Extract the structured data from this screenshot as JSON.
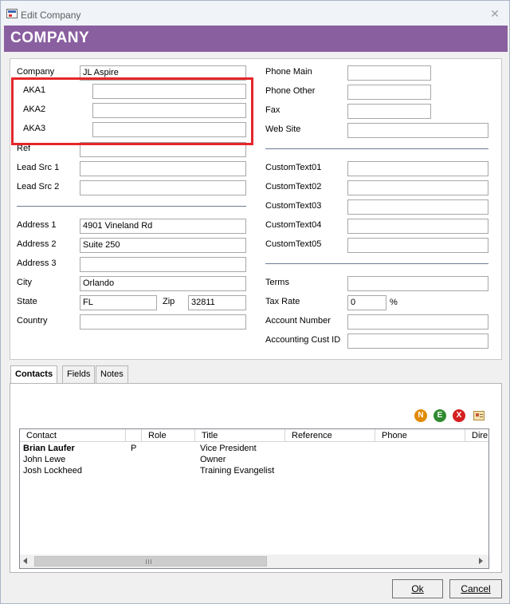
{
  "window": {
    "title": "Edit Company",
    "close_glyph": "✕"
  },
  "header": {
    "title": "COMPANY",
    "accent_color": "#8a5fa0"
  },
  "left": {
    "company": {
      "label": "Company",
      "value": "JL Aspire"
    },
    "aka1": {
      "label": "AKA1",
      "value": ""
    },
    "aka2": {
      "label": "AKA2",
      "value": ""
    },
    "aka3": {
      "label": "AKA3",
      "value": ""
    },
    "ref": {
      "label": "Ref",
      "value": ""
    },
    "lead_src_1": {
      "label": "Lead Src 1",
      "value": ""
    },
    "lead_src_2": {
      "label": "Lead Src 2",
      "value": ""
    },
    "address1": {
      "label": "Address 1",
      "value": "4901 Vineland Rd"
    },
    "address2": {
      "label": "Address 2",
      "value": "Suite 250"
    },
    "address3": {
      "label": "Address 3",
      "value": ""
    },
    "city": {
      "label": "City",
      "value": "Orlando"
    },
    "state": {
      "label": "State",
      "value": "FL"
    },
    "zip": {
      "label": "Zip",
      "value": "32811"
    },
    "country": {
      "label": "Country",
      "value": ""
    }
  },
  "right": {
    "phone_main": {
      "label": "Phone Main",
      "value": ""
    },
    "phone_other": {
      "label": "Phone Other",
      "value": ""
    },
    "fax": {
      "label": "Fax",
      "value": ""
    },
    "web_site": {
      "label": "Web Site",
      "value": ""
    },
    "custom1": {
      "label": "CustomText01",
      "value": ""
    },
    "custom2": {
      "label": "CustomText02",
      "value": ""
    },
    "custom3": {
      "label": "CustomText03",
      "value": ""
    },
    "custom4": {
      "label": "CustomText04",
      "value": ""
    },
    "custom5": {
      "label": "CustomText05",
      "value": ""
    },
    "terms": {
      "label": "Terms",
      "value": ""
    },
    "tax_rate": {
      "label": "Tax Rate",
      "value": "0",
      "unit": "%"
    },
    "account_number": {
      "label": "Account Number",
      "value": ""
    },
    "accounting_cust_id": {
      "label": "Accounting Cust ID",
      "value": ""
    }
  },
  "tabs": [
    "Contacts",
    "Fields",
    "Notes"
  ],
  "actions": {
    "new": "N",
    "edit": "E",
    "delete": "X"
  },
  "contacts": {
    "columns": [
      "Contact",
      "",
      "Role",
      "Title",
      "Reference",
      "Phone",
      "Dire"
    ],
    "rows": [
      {
        "contact": "Brian Laufer",
        "flag": "P",
        "role": "",
        "title": "Vice President"
      },
      {
        "contact": "John Lewe",
        "flag": "",
        "role": "",
        "title": "Owner"
      },
      {
        "contact": "Josh Lockheed",
        "flag": "",
        "role": "",
        "title": "Training Evangelist"
      }
    ]
  },
  "buttons": {
    "ok": "Ok",
    "cancel": "Cancel"
  }
}
